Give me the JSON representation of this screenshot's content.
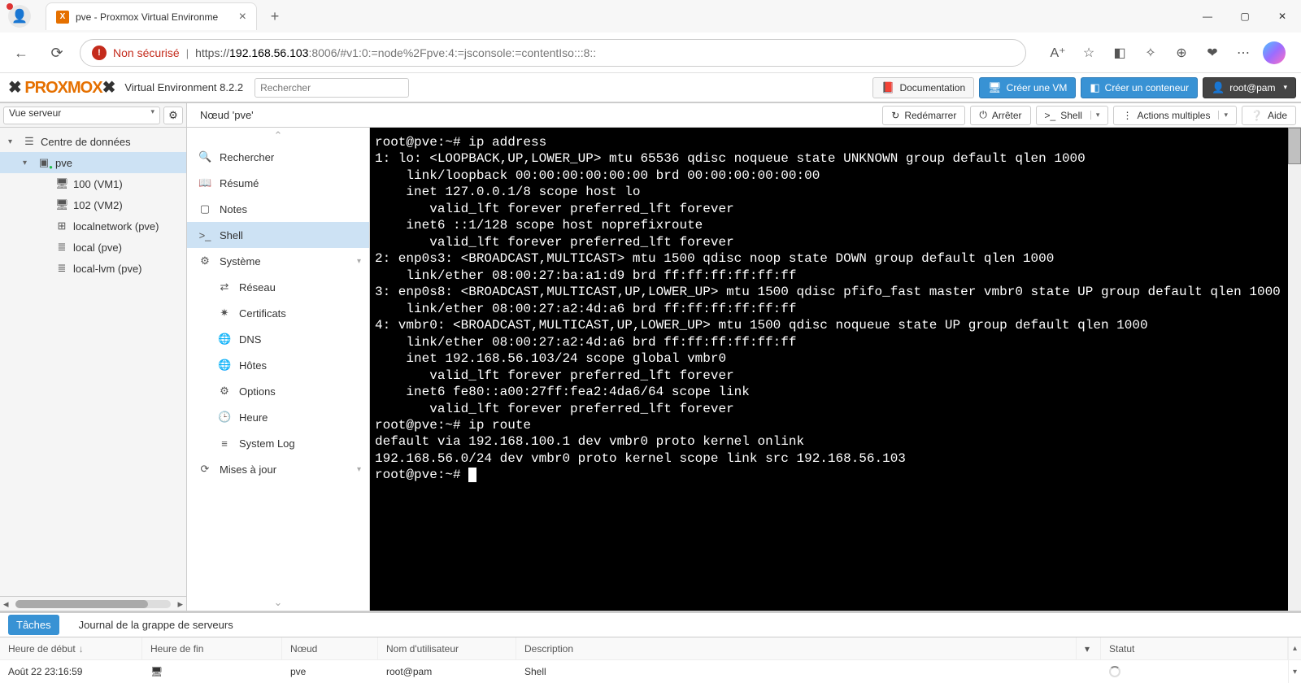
{
  "browser": {
    "tab_title": "pve - Proxmox Virtual Environme",
    "security_text": "Non sécurisé",
    "url_https": "https://",
    "url_host": "192.168.56.103",
    "url_rest": ":8006/#v1:0:=node%2Fpve:4:=jsconsole:=contentIso:::8::"
  },
  "header": {
    "logo_text": "PROXMOX",
    "version": "Virtual Environment 8.2.2",
    "search_placeholder": "Rechercher",
    "doc_btn": "Documentation",
    "create_vm": "Créer une VM",
    "create_ct": "Créer un conteneur",
    "user": "root@pam"
  },
  "tree": {
    "view_label": "Vue serveur",
    "items": [
      {
        "label": "Centre de données",
        "depth": 0,
        "icon": "server",
        "arrow": "▾"
      },
      {
        "label": "pve",
        "depth": 1,
        "icon": "node",
        "arrow": "▾",
        "selected": true,
        "green": true
      },
      {
        "label": "100 (VM1)",
        "depth": 2,
        "icon": "display"
      },
      {
        "label": "102 (VM2)",
        "depth": 2,
        "icon": "display"
      },
      {
        "label": "localnetwork (pve)",
        "depth": 2,
        "icon": "network"
      },
      {
        "label": "local (pve)",
        "depth": 2,
        "icon": "storage"
      },
      {
        "label": "local-lvm (pve)",
        "depth": 2,
        "icon": "storage"
      }
    ]
  },
  "node_header": {
    "title": "Nœud 'pve'",
    "restart": "Redémarrer",
    "shutdown": "Arrêter",
    "shell": "Shell",
    "bulk": "Actions multiples",
    "help": "Aide"
  },
  "midnav": [
    {
      "label": "Rechercher",
      "icon": "🔍"
    },
    {
      "label": "Résumé",
      "icon": "📖"
    },
    {
      "label": "Notes",
      "icon": "▢"
    },
    {
      "label": "Shell",
      "icon": ">_",
      "selected": true
    },
    {
      "label": "Système",
      "icon": "⚙",
      "expandable": true
    },
    {
      "label": "Réseau",
      "icon": "⇄",
      "sub": true
    },
    {
      "label": "Certificats",
      "icon": "✷",
      "sub": true
    },
    {
      "label": "DNS",
      "icon": "🌐",
      "sub": true
    },
    {
      "label": "Hôtes",
      "icon": "🌐",
      "sub": true
    },
    {
      "label": "Options",
      "icon": "⚙",
      "sub": true
    },
    {
      "label": "Heure",
      "icon": "🕒",
      "sub": true
    },
    {
      "label": "System Log",
      "icon": "≡",
      "sub": true
    },
    {
      "label": "Mises à jour",
      "icon": "⟳",
      "expandable": true
    }
  ],
  "console": "root@pve:~# ip address\n1: lo: <LOOPBACK,UP,LOWER_UP> mtu 65536 qdisc noqueue state UNKNOWN group default qlen 1000\n    link/loopback 00:00:00:00:00:00 brd 00:00:00:00:00:00\n    inet 127.0.0.1/8 scope host lo\n       valid_lft forever preferred_lft forever\n    inet6 ::1/128 scope host noprefixroute\n       valid_lft forever preferred_lft forever\n2: enp0s3: <BROADCAST,MULTICAST> mtu 1500 qdisc noop state DOWN group default qlen 1000\n    link/ether 08:00:27:ba:a1:d9 brd ff:ff:ff:ff:ff:ff\n3: enp0s8: <BROADCAST,MULTICAST,UP,LOWER_UP> mtu 1500 qdisc pfifo_fast master vmbr0 state UP group default qlen 1000\n    link/ether 08:00:27:a2:4d:a6 brd ff:ff:ff:ff:ff:ff\n4: vmbr0: <BROADCAST,MULTICAST,UP,LOWER_UP> mtu 1500 qdisc noqueue state UP group default qlen 1000\n    link/ether 08:00:27:a2:4d:a6 brd ff:ff:ff:ff:ff:ff\n    inet 192.168.56.103/24 scope global vmbr0\n       valid_lft forever preferred_lft forever\n    inet6 fe80::a00:27ff:fea2:4da6/64 scope link\n       valid_lft forever preferred_lft forever\nroot@pve:~# ip route\ndefault via 192.168.100.1 dev vmbr0 proto kernel onlink\n192.168.56.0/24 dev vmbr0 proto kernel scope link src 192.168.56.103\nroot@pve:~# ",
  "bottom": {
    "tab_tasks": "Tâches",
    "tab_cluster": "Journal de la grappe de serveurs",
    "columns": {
      "start": "Heure de début",
      "end": "Heure de fin",
      "node": "Nœud",
      "user": "Nom d'utilisateur",
      "desc": "Description",
      "status": "Statut"
    },
    "row": {
      "start": "Août 22 23:16:59",
      "end_icon": "🖥",
      "node": "pve",
      "user": "root@pam",
      "desc": "Shell"
    }
  }
}
